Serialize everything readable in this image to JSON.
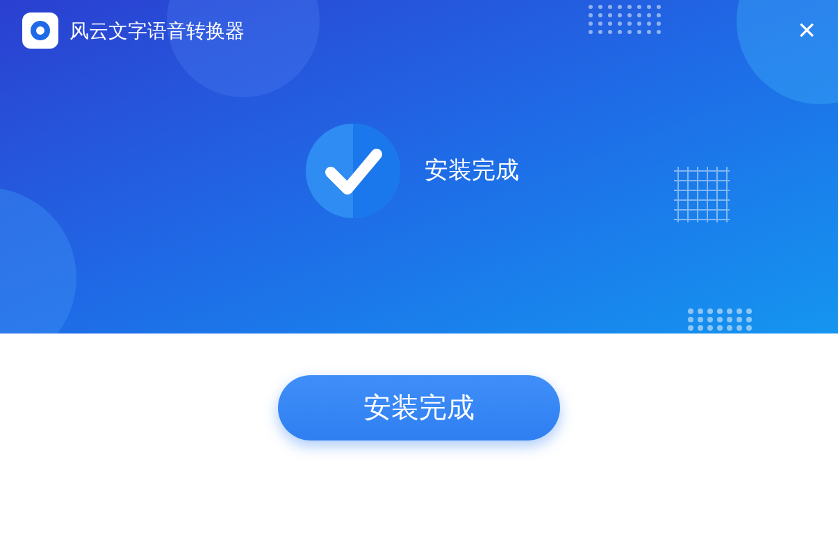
{
  "window": {
    "title": "风云文字语音转换器",
    "close": "×"
  },
  "status": {
    "message": "安装完成"
  },
  "buttons": [
    {
      "label": "安装完成"
    }
  ]
}
